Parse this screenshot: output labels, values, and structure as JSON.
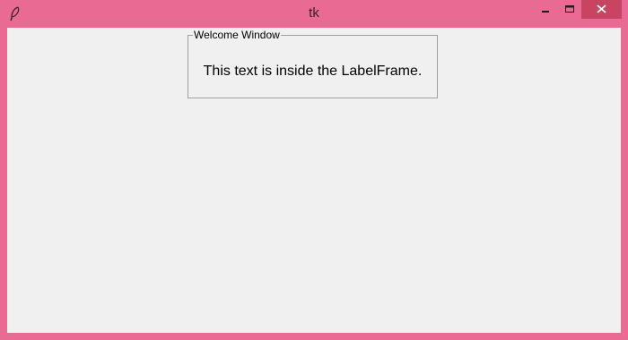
{
  "window": {
    "title": "tk",
    "titlebar_color": "#e96b93",
    "close_button_color": "#c74560"
  },
  "labelframe": {
    "title": "Welcome Window",
    "text": "This text is inside the LabelFrame."
  },
  "icons": {
    "app": "feather-icon",
    "minimize": "minimize-icon",
    "maximize": "maximize-icon",
    "close": "close-icon"
  }
}
